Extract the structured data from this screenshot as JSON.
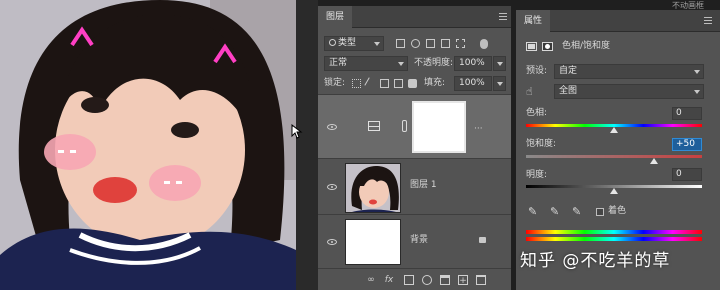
{
  "layers_panel": {
    "tab": "图层",
    "filter_kind": "类型",
    "blend_mode": "正常",
    "opacity_label": "不透明度:",
    "opacity_value": "100%",
    "lock_label": "锁定:",
    "fill_label": "填充:",
    "fill_value": "100%",
    "layers": [
      {
        "name": "",
        "type": "adjustment-hue-saturation",
        "selected": true
      },
      {
        "name": "图层 1",
        "type": "photo"
      },
      {
        "name": "背景",
        "type": "background",
        "locked": true
      }
    ],
    "bottom_icons": [
      "link-icon",
      "fx-icon",
      "mask-icon",
      "adjustment-icon",
      "group-icon",
      "new-layer-icon",
      "trash-icon"
    ],
    "fx_label": "fx"
  },
  "properties_panel": {
    "tab": "属性",
    "adjustment_title": "色相/饱和度",
    "preset_label": "预设:",
    "preset_value": "自定",
    "channel_value": "全图",
    "hue_label": "色相:",
    "hue_value": "0",
    "saturation_label": "饱和度:",
    "saturation_value": "+50",
    "lightness_label": "明度:",
    "lightness_value": "0",
    "colorize_label": "着色"
  },
  "top_right_hint": "不动画框",
  "watermark": "知乎 @不吃羊的草",
  "colors": {
    "panel_bg": "#535353",
    "dark_bg": "#1f1f1f",
    "selected_layer": "#6a6a6a",
    "focus_blue": "#2e8bd6"
  }
}
